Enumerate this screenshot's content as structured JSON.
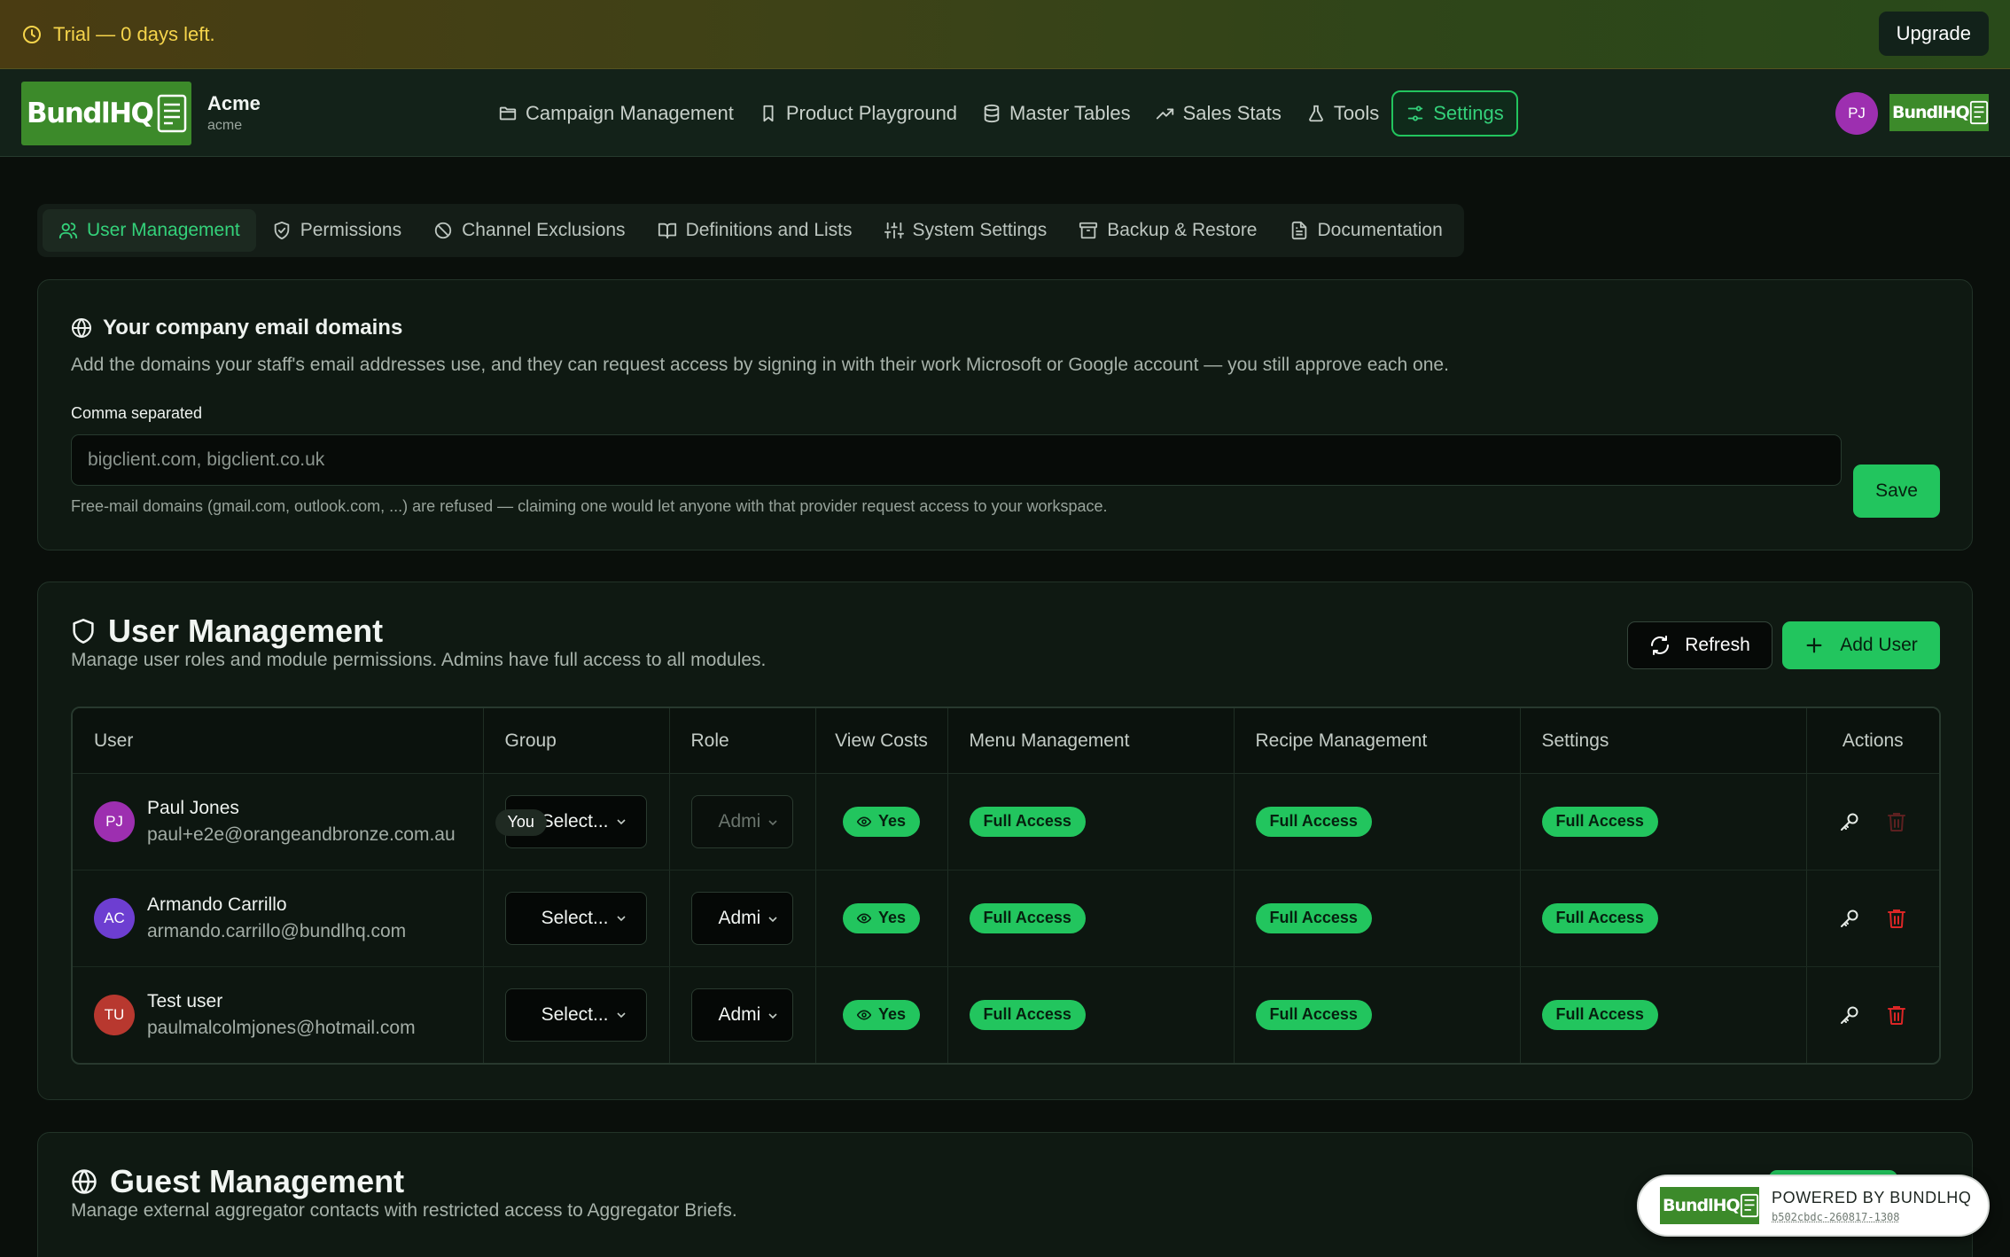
{
  "trial_banner": {
    "text": "Trial — 0 days left.",
    "upgrade_label": "Upgrade"
  },
  "header": {
    "logo_text": "BundlHQ",
    "org_name": "Acme",
    "org_slug": "acme",
    "nav": [
      {
        "label": "Campaign Management",
        "icon": "folder-icon"
      },
      {
        "label": "Product Playground",
        "icon": "bookmark-icon"
      },
      {
        "label": "Master Tables",
        "icon": "database-icon"
      },
      {
        "label": "Sales Stats",
        "icon": "trending-up-icon"
      },
      {
        "label": "Tools",
        "icon": "flask-icon"
      },
      {
        "label": "Settings",
        "icon": "sliders-icon",
        "active": true
      }
    ],
    "avatar_initials": "PJ"
  },
  "settings_tabs": [
    {
      "label": "User Management",
      "icon": "users-icon",
      "active": true
    },
    {
      "label": "Permissions",
      "icon": "shield-check-icon"
    },
    {
      "label": "Channel Exclusions",
      "icon": "ban-icon"
    },
    {
      "label": "Definitions and Lists",
      "icon": "book-open-icon"
    },
    {
      "label": "System Settings",
      "icon": "sliders-vertical-icon"
    },
    {
      "label": "Backup & Restore",
      "icon": "archive-icon"
    },
    {
      "label": "Documentation",
      "icon": "file-text-icon"
    }
  ],
  "domains": {
    "title": "Your company email domains",
    "description": "Add the domains your staff's email addresses use, and they can request access by signing in with their work Microsoft or Google account — you still approve each one.",
    "field_label": "Comma separated",
    "input_value": "",
    "input_placeholder": "bigclient.com, bigclient.co.uk",
    "hint": "Free-mail domains (gmail.com, outlook.com, ...) are refused — claiming one would let anyone with that provider request access to your workspace.",
    "save_label": "Save"
  },
  "user_management": {
    "title": "User Management",
    "subtitle": "Manage user roles and module permissions. Admins have full access to all modules.",
    "refresh_label": "Refresh",
    "add_user_label": "Add User",
    "columns": [
      "User",
      "Group",
      "Role",
      "View Costs",
      "Menu Management",
      "Recipe Management",
      "Settings",
      "Actions"
    ],
    "users": [
      {
        "initials": "PJ",
        "name": "Paul Jones",
        "email": "paul+e2e@orangeandbronze.com.au",
        "avatar_color": "#9d2fb0",
        "you_badge": "You",
        "group": "Select...",
        "role": "Admi",
        "role_disabled": true,
        "view_costs": "Yes",
        "menu": "Full Access",
        "recipe": "Full Access",
        "settings": "Full Access",
        "delete_enabled": false
      },
      {
        "initials": "AC",
        "name": "Armando Carrillo",
        "email": "armando.carrillo@bundlhq.com",
        "avatar_color": "#6d3ed1",
        "you_badge": "",
        "group": "Select...",
        "role": "Admi",
        "role_disabled": false,
        "view_costs": "Yes",
        "menu": "Full Access",
        "recipe": "Full Access",
        "settings": "Full Access",
        "delete_enabled": true
      },
      {
        "initials": "TU",
        "name": "Test user",
        "email": "paulmalcolmjones@hotmail.com",
        "avatar_color": "#b8382f",
        "you_badge": "",
        "group": "Select...",
        "role": "Admi",
        "role_disabled": false,
        "view_costs": "Yes",
        "menu": "Full Access",
        "recipe": "Full Access",
        "settings": "Full Access",
        "delete_enabled": true
      }
    ]
  },
  "guest_management": {
    "title": "Guest Management",
    "subtitle": "Manage external aggregator contacts with restricted access to Aggregator Briefs."
  },
  "powered_by": {
    "label": "POWERED BY BUNDLHQ",
    "build": "b502cbdc-260817-1308",
    "logo_text": "BundlHQ"
  },
  "colors": {
    "accent": "#22c55e",
    "warning": "#f5d44b",
    "danger": "#dc2626",
    "background": "#0a0f0b"
  }
}
